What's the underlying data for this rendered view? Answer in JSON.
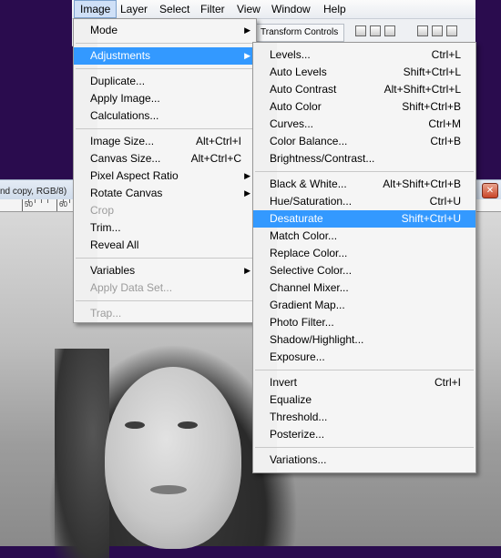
{
  "menubar": {
    "items": [
      "Image",
      "Layer",
      "Select",
      "Filter",
      "View",
      "Window",
      "Help"
    ]
  },
  "options_bar": {
    "transform_label": "Transform Controls"
  },
  "document": {
    "title": "nd copy, RGB/8)",
    "ruler_labels": [
      "50",
      "60"
    ],
    "close_glyph": "✕"
  },
  "image_menu": {
    "mode": "Mode",
    "adjustments": "Adjustments",
    "duplicate": "Duplicate...",
    "apply_image": "Apply Image...",
    "calculations": "Calculations...",
    "image_size": {
      "label": "Image Size...",
      "shortcut": "Alt+Ctrl+I"
    },
    "canvas_size": {
      "label": "Canvas Size...",
      "shortcut": "Alt+Ctrl+C"
    },
    "pixel_aspect": "Pixel Aspect Ratio",
    "rotate_canvas": "Rotate Canvas",
    "crop": "Crop",
    "trim": "Trim...",
    "reveal_all": "Reveal All",
    "variables": "Variables",
    "apply_data_set": "Apply Data Set...",
    "trap": "Trap..."
  },
  "adjustments_menu": {
    "items": [
      {
        "label": "Levels...",
        "shortcut": "Ctrl+L"
      },
      {
        "label": "Auto Levels",
        "shortcut": "Shift+Ctrl+L"
      },
      {
        "label": "Auto Contrast",
        "shortcut": "Alt+Shift+Ctrl+L"
      },
      {
        "label": "Auto Color",
        "shortcut": "Shift+Ctrl+B"
      },
      {
        "label": "Curves...",
        "shortcut": "Ctrl+M"
      },
      {
        "label": "Color Balance...",
        "shortcut": "Ctrl+B"
      },
      {
        "label": "Brightness/Contrast...",
        "shortcut": ""
      },
      {
        "label": "Black & White...",
        "shortcut": "Alt+Shift+Ctrl+B"
      },
      {
        "label": "Hue/Saturation...",
        "shortcut": "Ctrl+U"
      },
      {
        "label": "Desaturate",
        "shortcut": "Shift+Ctrl+U"
      },
      {
        "label": "Match Color...",
        "shortcut": ""
      },
      {
        "label": "Replace Color...",
        "shortcut": ""
      },
      {
        "label": "Selective Color...",
        "shortcut": ""
      },
      {
        "label": "Channel Mixer...",
        "shortcut": ""
      },
      {
        "label": "Gradient Map...",
        "shortcut": ""
      },
      {
        "label": "Photo Filter...",
        "shortcut": ""
      },
      {
        "label": "Shadow/Highlight...",
        "shortcut": ""
      },
      {
        "label": "Exposure...",
        "shortcut": ""
      },
      {
        "label": "Invert",
        "shortcut": "Ctrl+I"
      },
      {
        "label": "Equalize",
        "shortcut": ""
      },
      {
        "label": "Threshold...",
        "shortcut": ""
      },
      {
        "label": "Posterize...",
        "shortcut": ""
      },
      {
        "label": "Variations...",
        "shortcut": ""
      }
    ]
  },
  "colors": {
    "highlight": "#3399ff",
    "background": "#2a0c4e",
    "menu_bg": "#f5f5f5",
    "disabled_text": "#9b9b9b"
  }
}
